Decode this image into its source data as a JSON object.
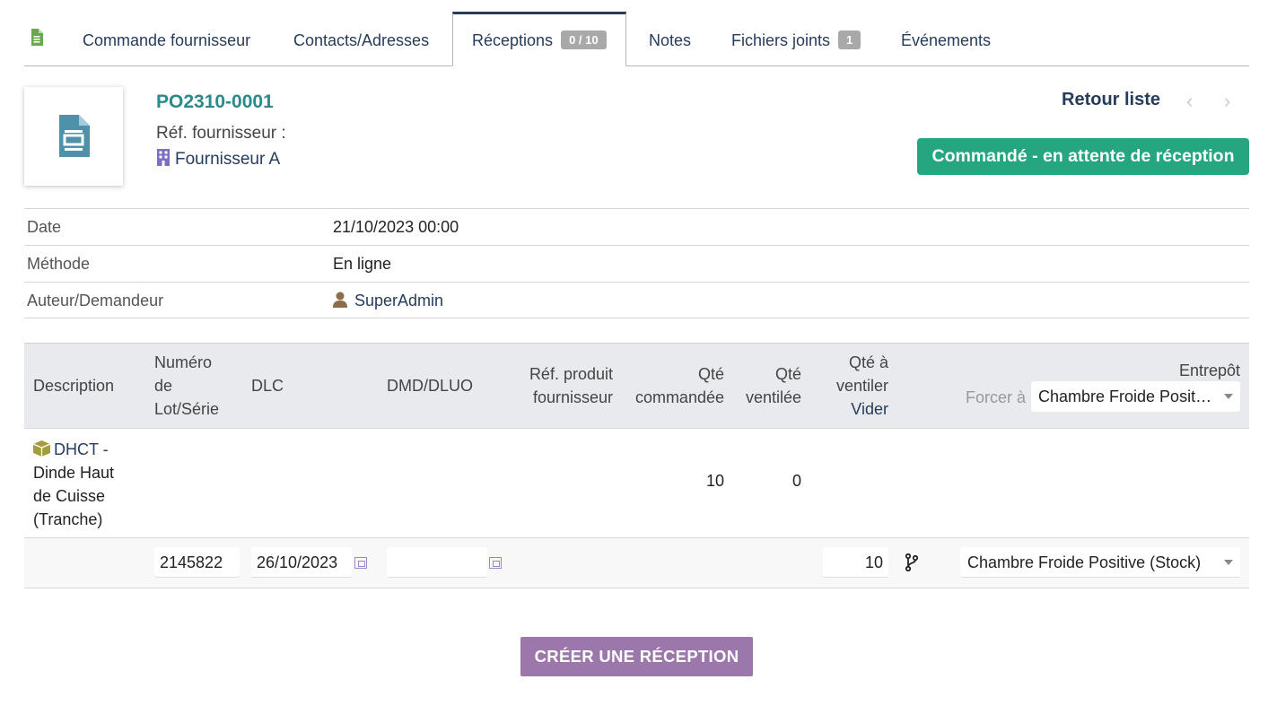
{
  "tabs": [
    {
      "label": "Commande fournisseur"
    },
    {
      "label": "Contacts/Adresses"
    },
    {
      "label": "Réceptions",
      "badge": "0 / 10"
    },
    {
      "label": "Notes"
    },
    {
      "label": "Fichiers joints",
      "badge": "1"
    },
    {
      "label": "Événements"
    }
  ],
  "header": {
    "ref": "PO2310-0001",
    "ref_supplier_label": "Réf. fournisseur :",
    "supplier": "Fournisseur A",
    "back_link": "Retour liste",
    "prev_glyph": "‹",
    "next_glyph": "›",
    "status": "Commandé - en attente de réception"
  },
  "info": [
    {
      "label": "Date",
      "value": "21/10/2023 00:00"
    },
    {
      "label": "Méthode",
      "value": "En ligne"
    },
    {
      "label": "Auteur/Demandeur",
      "value": "SuperAdmin"
    }
  ],
  "columns": {
    "description": "Description",
    "lot_1": "Numéro",
    "lot_2": "de",
    "lot_3": "Lot/Série",
    "dlc": "DLC",
    "dmd": "DMD/DLUO",
    "ref_prod_1": "Réf. produit",
    "ref_prod_2": "fournisseur",
    "qty_ordered_1": "Qté",
    "qty_ordered_2": "commandée",
    "qty_dispatched_1": "Qté",
    "qty_dispatched_2": "ventilée",
    "qty_to_dispatch_1": "Qté à",
    "qty_to_dispatch_2": "ventiler",
    "clear_link": "Vider",
    "warehouse": "Entrepôt",
    "force_label": "Forcer à",
    "force_select": "Chambre Froide Positive (Stock)"
  },
  "product": {
    "code": "DHCT -",
    "name_1": "Dinde Haut",
    "name_2": "de Cuisse",
    "name_3": "(Tranche)",
    "qty_ordered": "10",
    "qty_dispatched": "0"
  },
  "entry": {
    "lot": "2145822",
    "dlc": "26/10/2023",
    "dmd": "",
    "qty": "10",
    "warehouse": "Chambre Froide Positive (Stock)"
  },
  "actions": {
    "create": "CRÉER UNE RÉCEPTION"
  },
  "colors": {
    "accent": "#263c5c",
    "status": "#25a580",
    "button": "#9c77ab",
    "ref": "#2c8a8a"
  }
}
